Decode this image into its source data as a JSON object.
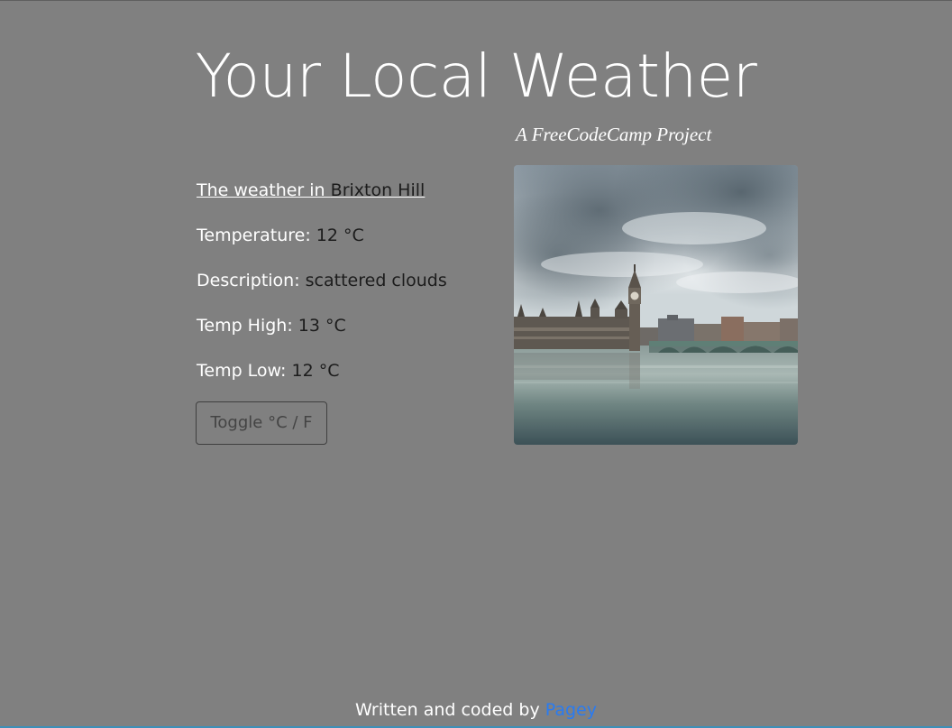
{
  "header": {
    "title": "Your Local Weather",
    "subtitle": "A FreeCodeCamp Project"
  },
  "weather": {
    "location_prefix": "The weather in ",
    "location": "Brixton Hill",
    "temperature_label": "Temperature: ",
    "temperature_value": "12 °C",
    "description_label": "Description: ",
    "description_value": "scattered clouds",
    "temp_high_label": "Temp High: ",
    "temp_high_value": "13 °C",
    "temp_low_label": "Temp Low: ",
    "temp_low_value": "12 °C",
    "toggle_label": "Toggle °C / F"
  },
  "image": {
    "subject": "london-westminster-skyline-photo"
  },
  "footer": {
    "credit_prefix": "Written and coded by ",
    "author": "Pagey"
  },
  "colors": {
    "background": "#808080",
    "text": "#ffffff",
    "value_text": "#1c1c1c",
    "link": "#2a7bf0"
  }
}
